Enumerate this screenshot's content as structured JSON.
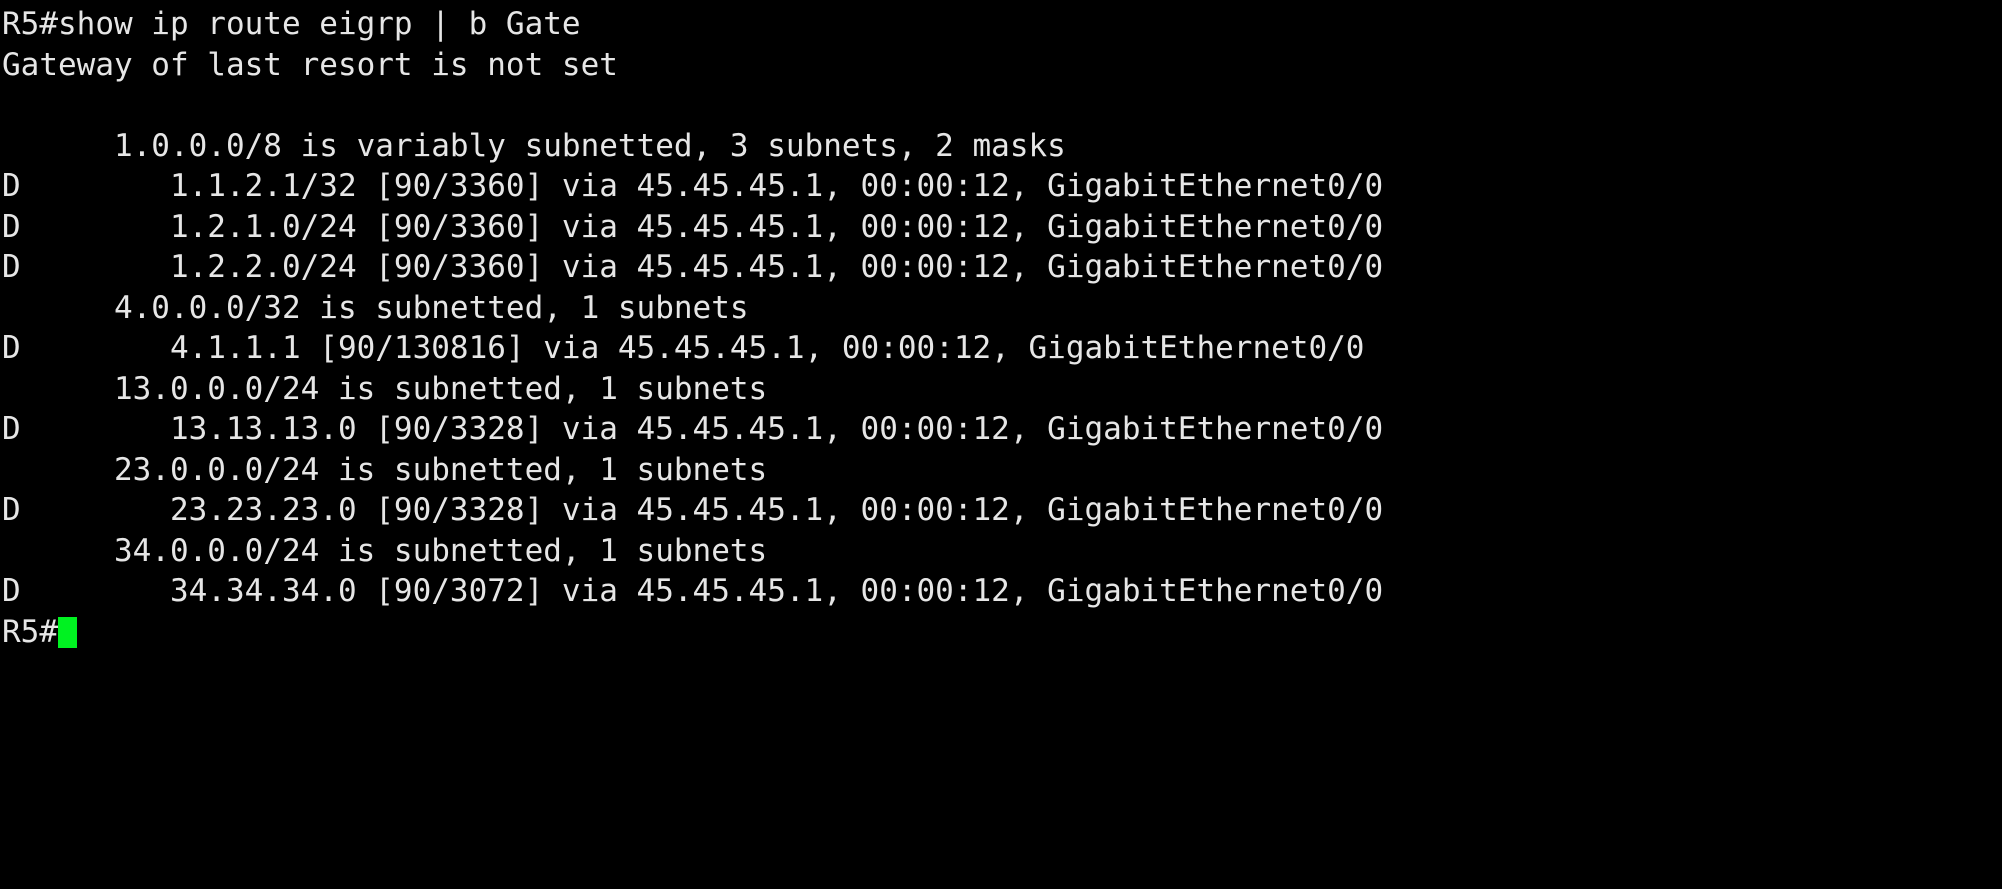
{
  "terminal": {
    "device_hostname": "R5",
    "prompt": "R5#",
    "background_color": "#000000",
    "foreground_color": "#e6e6e6",
    "cursor_color": "#00f221",
    "command_line": "R5#show ip route eigrp | b Gate",
    "command": "show ip route eigrp | b Gate",
    "gateway_line": "Gateway of last resort is not set",
    "blank_line": " ",
    "lines": [
      "R5#show ip route eigrp | b Gate",
      "Gateway of last resort is not set",
      " ",
      "      1.0.0.0/8 is variably subnetted, 3 subnets, 2 masks",
      "D        1.1.2.1/32 [90/3360] via 45.45.45.1, 00:00:12, GigabitEthernet0/0",
      "D        1.2.1.0/24 [90/3360] via 45.45.45.1, 00:00:12, GigabitEthernet0/0",
      "D        1.2.2.0/24 [90/3360] via 45.45.45.1, 00:00:12, GigabitEthernet0/0",
      "      4.0.0.0/32 is subnetted, 1 subnets",
      "D        4.1.1.1 [90/130816] via 45.45.45.1, 00:00:12, GigabitEthernet0/0",
      "      13.0.0.0/24 is subnetted, 1 subnets",
      "D        13.13.13.0 [90/3328] via 45.45.45.1, 00:00:12, GigabitEthernet0/0",
      "      23.0.0.0/24 is subnetted, 1 subnets",
      "D        23.23.23.0 [90/3328] via 45.45.45.1, 00:00:12, GigabitEthernet0/0",
      "      34.0.0.0/24 is subnetted, 1 subnets",
      "D        34.34.34.0 [90/3072] via 45.45.45.1, 00:00:12, GigabitEthernet0/0"
    ],
    "route_table": {
      "protocol_filter": "eigrp",
      "gateway_of_last_resort": "not set",
      "groups": [
        {
          "header": "      1.0.0.0/8 is variably subnetted, 3 subnets, 2 masks",
          "network": "1.0.0.0/8",
          "subnetting": "variably subnetted",
          "subnets": 3,
          "masks": 2,
          "routes": [
            {
              "line": "D        1.1.2.1/32 [90/3360] via 45.45.45.1, 00:00:12, GigabitEthernet0/0",
              "code": "D",
              "prefix": "1.1.2.1/32",
              "admin_distance": 90,
              "metric": 3360,
              "next_hop": "45.45.45.1",
              "age": "00:00:12",
              "interface": "GigabitEthernet0/0"
            },
            {
              "line": "D        1.2.1.0/24 [90/3360] via 45.45.45.1, 00:00:12, GigabitEthernet0/0",
              "code": "D",
              "prefix": "1.2.1.0/24",
              "admin_distance": 90,
              "metric": 3360,
              "next_hop": "45.45.45.1",
              "age": "00:00:12",
              "interface": "GigabitEthernet0/0"
            },
            {
              "line": "D        1.2.2.0/24 [90/3360] via 45.45.45.1, 00:00:12, GigabitEthernet0/0",
              "code": "D",
              "prefix": "1.2.2.0/24",
              "admin_distance": 90,
              "metric": 3360,
              "next_hop": "45.45.45.1",
              "age": "00:00:12",
              "interface": "GigabitEthernet0/0"
            }
          ]
        },
        {
          "header": "      4.0.0.0/32 is subnetted, 1 subnets",
          "network": "4.0.0.0/32",
          "subnetting": "subnetted",
          "subnets": 1,
          "routes": [
            {
              "line": "D        4.1.1.1 [90/130816] via 45.45.45.1, 00:00:12, GigabitEthernet0/0",
              "code": "D",
              "prefix": "4.1.1.1",
              "admin_distance": 90,
              "metric": 130816,
              "next_hop": "45.45.45.1",
              "age": "00:00:12",
              "interface": "GigabitEthernet0/0"
            }
          ]
        },
        {
          "header": "      13.0.0.0/24 is subnetted, 1 subnets",
          "network": "13.0.0.0/24",
          "subnetting": "subnetted",
          "subnets": 1,
          "routes": [
            {
              "line": "D        13.13.13.0 [90/3328] via 45.45.45.1, 00:00:12, GigabitEthernet0/0",
              "code": "D",
              "prefix": "13.13.13.0",
              "admin_distance": 90,
              "metric": 3328,
              "next_hop": "45.45.45.1",
              "age": "00:00:12",
              "interface": "GigabitEthernet0/0"
            }
          ]
        },
        {
          "header": "      23.0.0.0/24 is subnetted, 1 subnets",
          "network": "23.0.0.0/24",
          "subnetting": "subnetted",
          "subnets": 1,
          "routes": [
            {
              "line": "D        23.23.23.0 [90/3328] via 45.45.45.1, 00:00:12, GigabitEthernet0/0",
              "code": "D",
              "prefix": "23.23.23.0",
              "admin_distance": 90,
              "metric": 3328,
              "next_hop": "45.45.45.1",
              "age": "00:00:12",
              "interface": "GigabitEthernet0/0"
            }
          ]
        },
        {
          "header": "      34.0.0.0/24 is subnetted, 1 subnets",
          "network": "34.0.0.0/24",
          "subnetting": "subnetted",
          "subnets": 1,
          "routes": [
            {
              "line": "D        34.34.34.0 [90/3072] via 45.45.45.1, 00:00:12, GigabitEthernet0/0",
              "code": "D",
              "prefix": "34.34.34.0",
              "admin_distance": 90,
              "metric": 3072,
              "next_hop": "45.45.45.1",
              "age": "00:00:12",
              "interface": "GigabitEthernet0/0"
            }
          ]
        }
      ]
    }
  }
}
